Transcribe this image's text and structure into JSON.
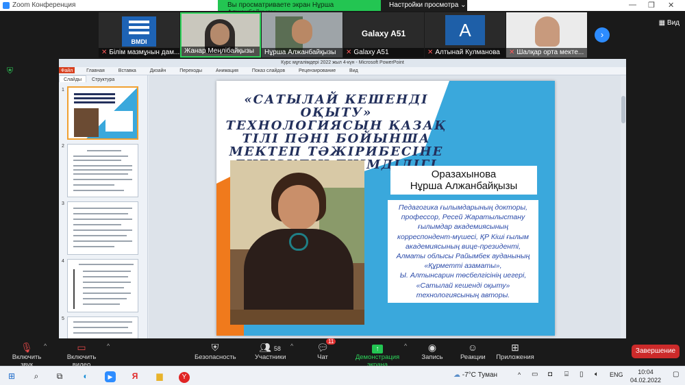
{
  "window": {
    "app_title": "Zoom Конференция",
    "share_banner": "Вы просматриваете экран Нұрша Алжанбайқызы",
    "view_options": "Настройки просмотра",
    "view_label": "Вид"
  },
  "participants": [
    {
      "name": "Білім мазмұнын дам...",
      "tile_text": "BMDI"
    },
    {
      "name": "Жанар Меңлібайқызы",
      "tile_text": ""
    },
    {
      "name": "Нұрша Алжанбайқызы",
      "tile_text": ""
    },
    {
      "name": "Galaxy A51",
      "tile_text": "Galaxy A51"
    },
    {
      "name": "Алтынай Кулманова",
      "tile_text": "A"
    },
    {
      "name": "Шалқар орта мекте...",
      "tile_text": ""
    }
  ],
  "ppt": {
    "window_title": "Курс мұғалімдері 2022 жыл 4-күн - Microsoft PowerPoint",
    "ribbon_tabs": [
      "Файл",
      "Главная",
      "Вставка",
      "Дизайн",
      "Переходы",
      "Анимация",
      "Показ слайдов",
      "Рецензирование",
      "Вид"
    ],
    "sidebar_tabs": [
      "Слайды",
      "Структура"
    ],
    "slide_numbers": [
      "1",
      "2",
      "3",
      "4",
      "5"
    ]
  },
  "slide": {
    "title": "«САТЫЛАЙ КЕШЕНДІ ОҚЫТУ» ТЕХНОЛОГИЯСЫН ҚАЗАҚ ТІЛІ ПӘНІ БОЙЫНША МЕКТЕП ТӘЖІРИБЕСІНЕ ЕНГІЗУДІҢ ТИІМДІЛІГІ",
    "name_line1": "Оразахынова",
    "name_line2": "Нұрша Алжанбайқызы",
    "bio": [
      "Педагогика ғылымдарының докторы,",
      "профессор, Ресей Жаратылыстану",
      "ғылымдар академиясының",
      "корреспондент-мүшесі, ҚР Кіші ғылым",
      "академиясының вице-президенті,",
      "Алматы облысы Райымбек ауданының",
      "«Құрметті азаматы»,",
      "Ы. Алтынсарин төсбелгісінің иегері,",
      "«Сатылай кешенді оқыту»",
      "технологиясының авторы."
    ],
    "colors": {
      "blue": "#3aa8dc",
      "orange": "#f07a1c",
      "title": "#23305c"
    }
  },
  "controls": {
    "unmute": "Включить звук",
    "start_video": "Включить видео",
    "security": "Безопасность",
    "participants": "Участники",
    "participants_count": "58",
    "chat": "Чат",
    "chat_badge": "11",
    "share": "Демонстрация экрана",
    "record": "Запись",
    "reactions": "Реакции",
    "apps": "Приложения",
    "end": "Завершение"
  },
  "taskbar": {
    "weather": "-7°C  Туман",
    "lang": "ENG",
    "time": "10:04",
    "date": "04.02.2022"
  }
}
